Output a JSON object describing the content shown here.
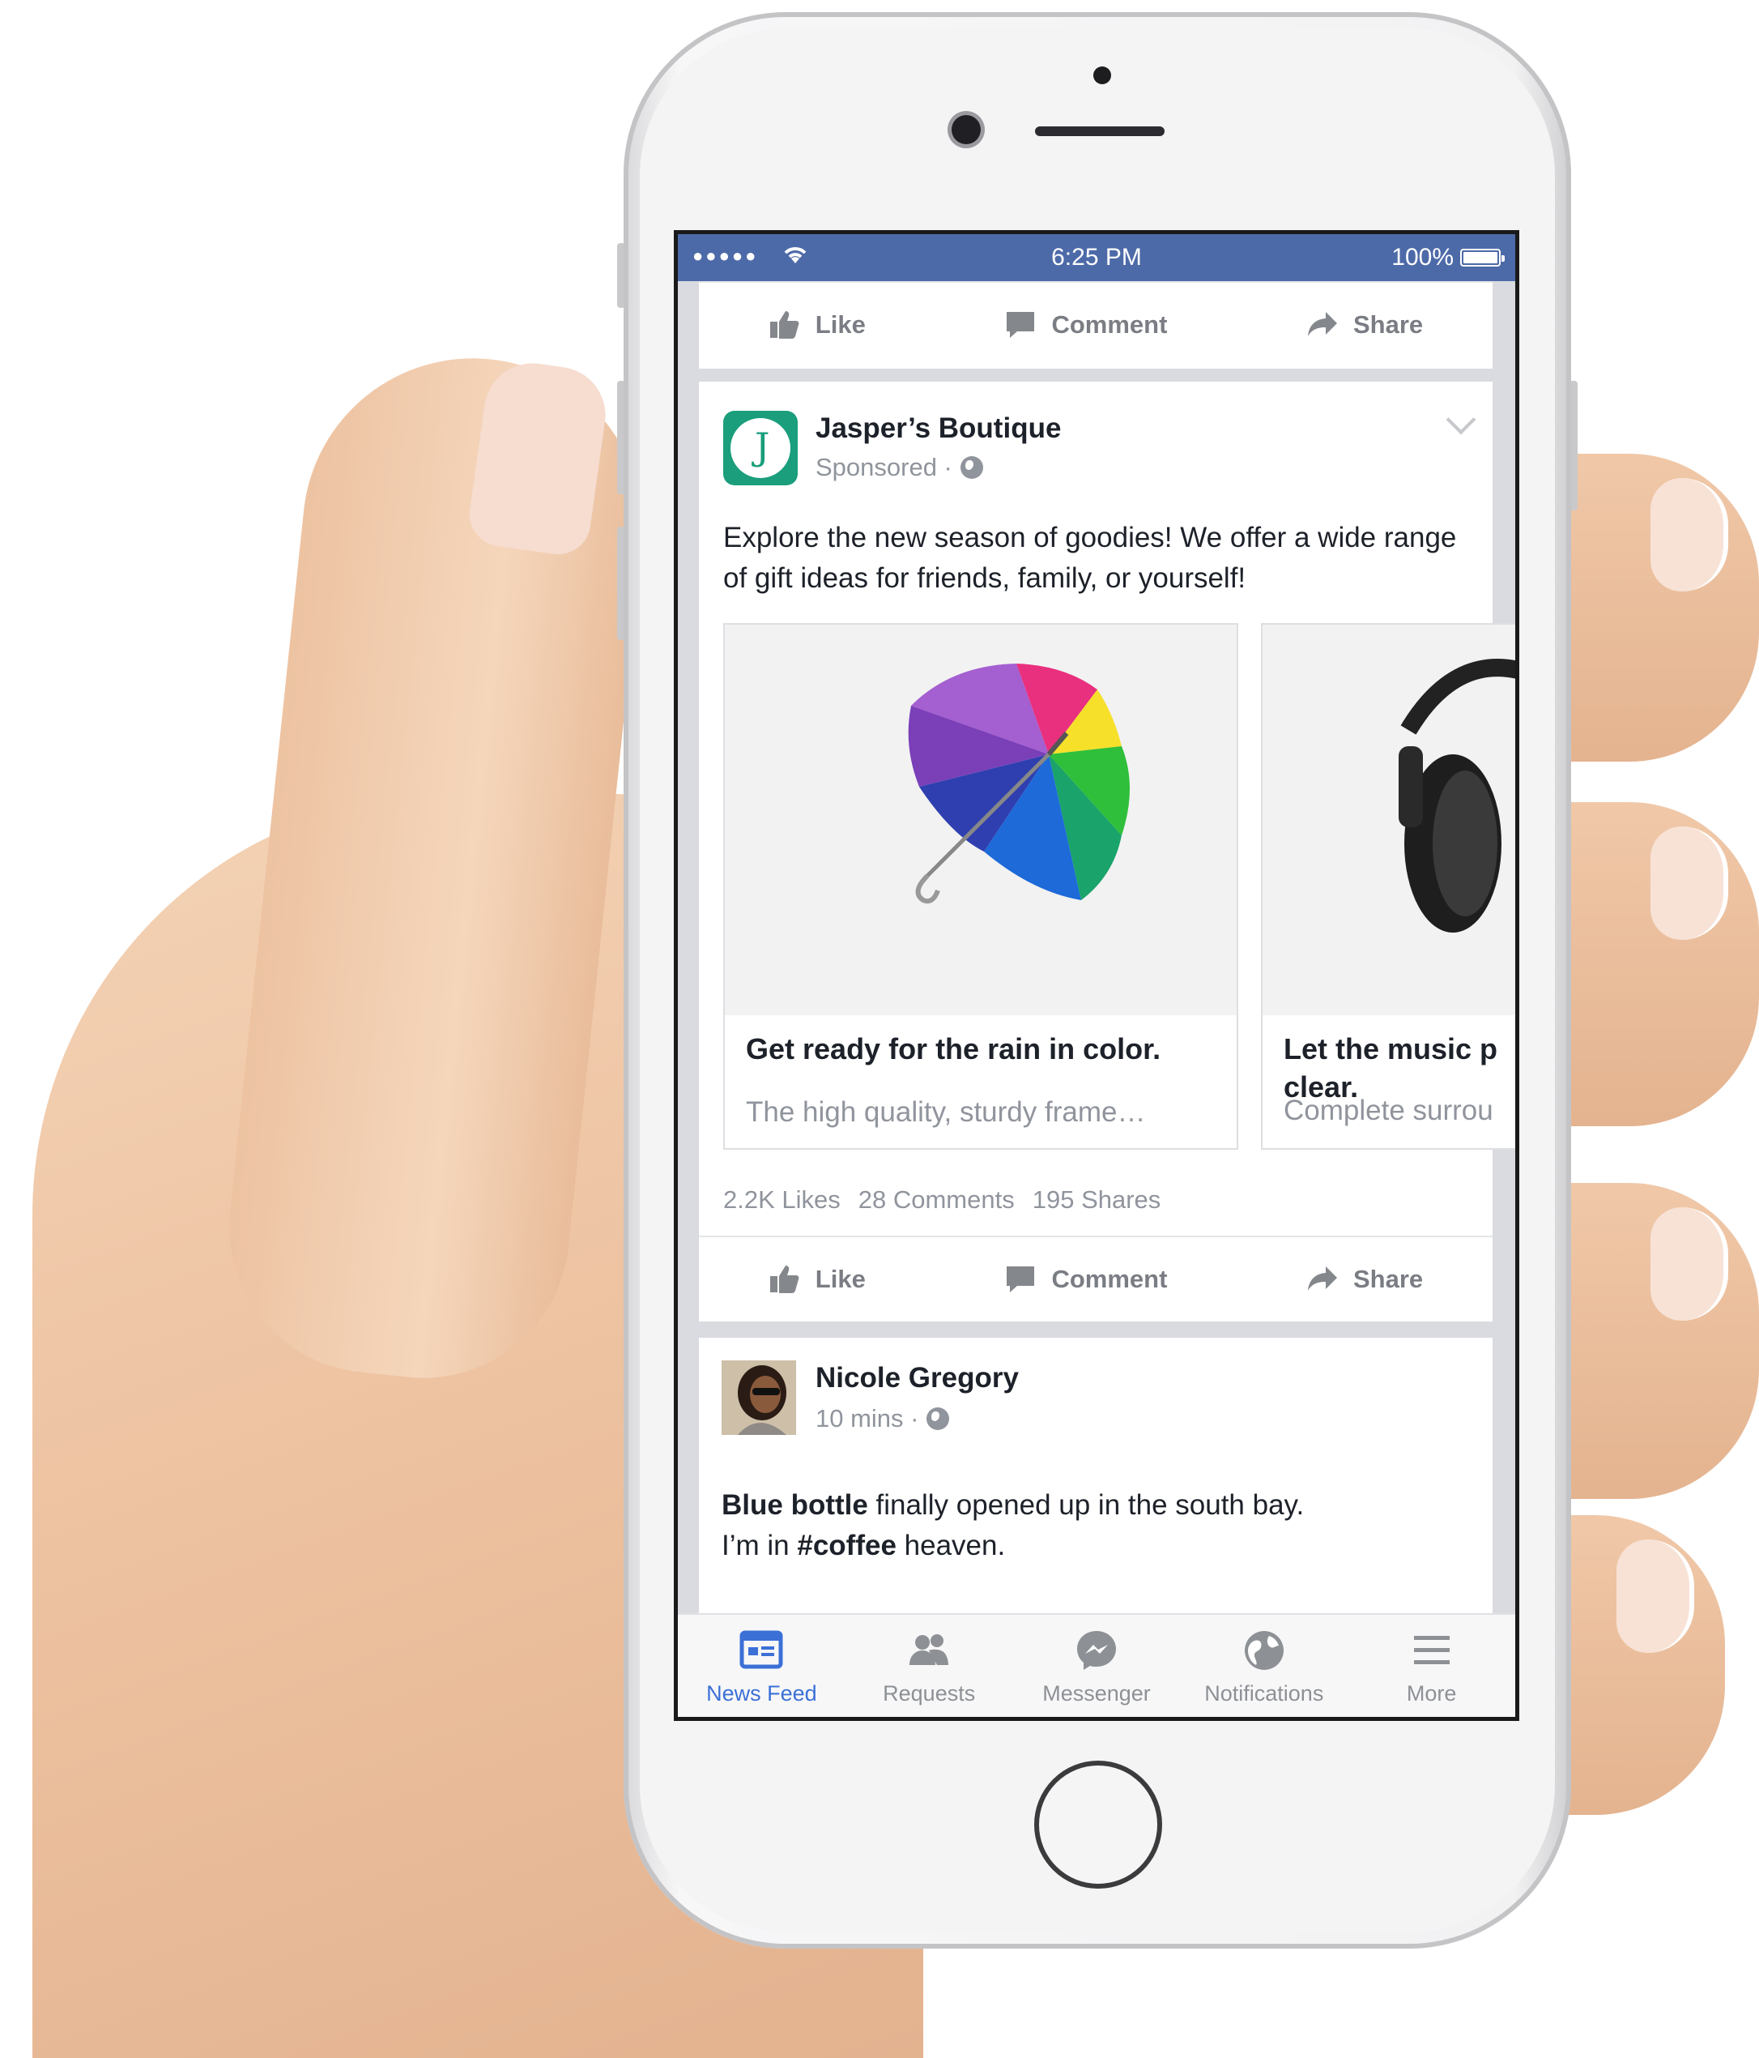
{
  "status_bar": {
    "time": "6:25 PM",
    "battery": "100%",
    "signal": "●●●●●"
  },
  "top_card": {
    "like": "Like",
    "comment": "Comment",
    "share": "Share"
  },
  "ad_post": {
    "page_name": "Jasper’s Boutique",
    "meta": "Sponsored ·",
    "text": "Explore the new season of goodies! We offer a wide range of gift ideas for friends, family, or yourself!",
    "carousel": [
      {
        "title": "Get ready for the rain in color.",
        "description": "The high quality, sturdy frame…",
        "image": "umbrella-image"
      },
      {
        "title": "Let the music p\nclear.",
        "description": "Complete surrou",
        "image": "headphones-image"
      }
    ],
    "likes": "2.2K Likes",
    "comments": "28 Comments",
    "shares": "195 Shares",
    "like": "Like",
    "comment": "Comment",
    "share": "Share"
  },
  "user_post": {
    "name": "Nicole Gregory",
    "time": "10 mins ·",
    "text_bold_1": "Blue bottle",
    "text_1": " finally opened up in the south bay.",
    "text_2": "I’m in ",
    "text_bold_2": "#coffee",
    "text_3": " heaven."
  },
  "tabs": [
    {
      "label": "News Feed",
      "icon": "news-feed-icon",
      "active": true
    },
    {
      "label": "Requests",
      "icon": "friend-requests-icon",
      "active": false
    },
    {
      "label": "Messenger",
      "icon": "messenger-icon",
      "active": false
    },
    {
      "label": "Notifications",
      "icon": "globe-notifications-icon",
      "active": false
    },
    {
      "label": "More",
      "icon": "hamburger-menu-icon",
      "active": false
    }
  ],
  "colors": {
    "status_bar": "#4d6aa8",
    "active_tab": "#3b70d6",
    "brand_logo": "#1a9e7b"
  }
}
